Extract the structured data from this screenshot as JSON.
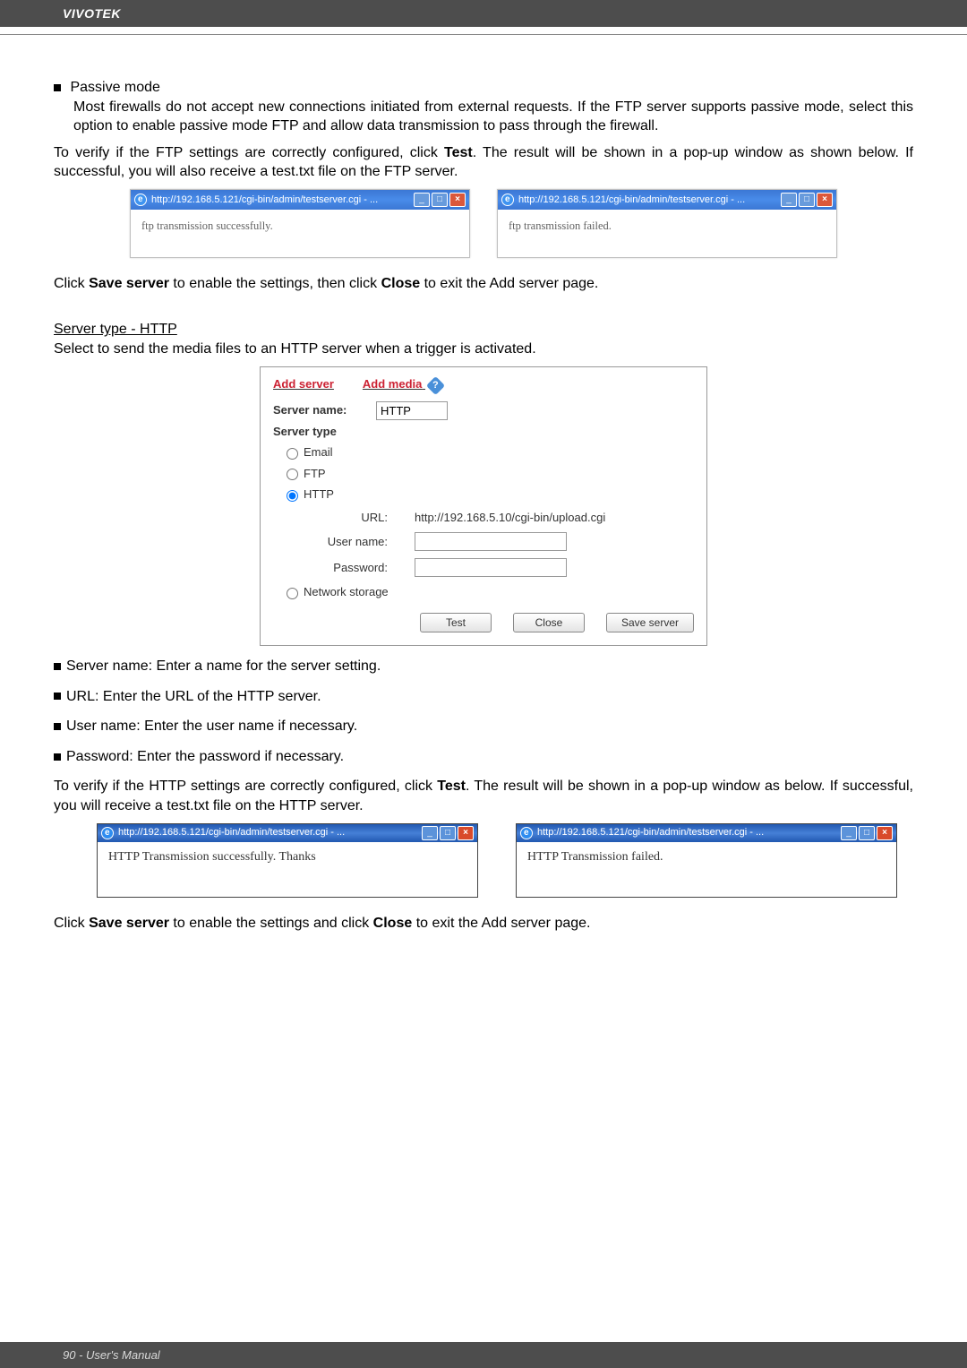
{
  "brand": "VIVOTEK",
  "footer": "90 - User's Manual",
  "section1": {
    "bullet_head": "Passive mode",
    "bullet_body": "Most firewalls do not accept new connections initiated from external requests. If the FTP server supports passive mode, select this option to enable passive mode FTP and allow data transmission to pass through the firewall.",
    "verify_a": "To verify if the FTP settings are correctly configured, click ",
    "verify_bold": "Test",
    "verify_b": ". The result will be shown in a pop-up window as shown below. If successful, you will also receive a test.txt file on the FTP server."
  },
  "ftp_popups": {
    "success": {
      "title": "http://192.168.5.121/cgi-bin/admin/testserver.cgi - ...",
      "msg": "ftp transmission successfully."
    },
    "fail": {
      "title": "http://192.168.5.121/cgi-bin/admin/testserver.cgi - ...",
      "msg": "ftp transmission failed."
    }
  },
  "save_line1_a": "Click ",
  "save_line1_b": "Save server",
  "save_line1_c": " to enable the settings, then click ",
  "save_line1_d": "Close",
  "save_line1_e": " to exit the Add server page.",
  "http_head": "Server type - HTTP",
  "http_desc": "Select to send the media files to an HTTP server when a trigger is activated.",
  "dialog": {
    "tab_add_server": "Add server",
    "tab_add_media": "Add media",
    "server_name_label": "Server name:",
    "server_name_value": "HTTP",
    "server_type_label": "Server type",
    "radios": {
      "email": "Email",
      "ftp": "FTP",
      "http": "HTTP",
      "netstorage": "Network storage"
    },
    "selected": "http",
    "url_label": "URL:",
    "url_value": "http://192.168.5.10/cgi-bin/upload.cgi",
    "username_label": "User name:",
    "username_value": "",
    "password_label": "Password:",
    "password_value": "",
    "btn_test": "Test",
    "btn_close": "Close",
    "btn_save": "Save server"
  },
  "bullets2": {
    "b1": "Server name: Enter a name for the server setting.",
    "b2": "URL: Enter the URL of the HTTP server.",
    "b3": "User name: Enter the user name if necessary.",
    "b4": "Password: Enter the password if necessary."
  },
  "verify2_a": "To verify if the HTTP settings are correctly configured, click ",
  "verify2_bold": "Test",
  "verify2_b": ". The result will be shown in a pop-up window as below. If successful, you will receive a test.txt file on the HTTP server.",
  "http_popups": {
    "success": {
      "title": "http://192.168.5.121/cgi-bin/admin/testserver.cgi - ...",
      "msg": "HTTP Transmission successfully. Thanks"
    },
    "fail": {
      "title": "http://192.168.5.121/cgi-bin/admin/testserver.cgi - ...",
      "msg": "HTTP Transmission failed."
    }
  },
  "save_line2_a": "Click ",
  "save_line2_b": "Save server",
  "save_line2_c": " to enable the settings and click ",
  "save_line2_d": "Close",
  "save_line2_e": " to exit the Add server page."
}
